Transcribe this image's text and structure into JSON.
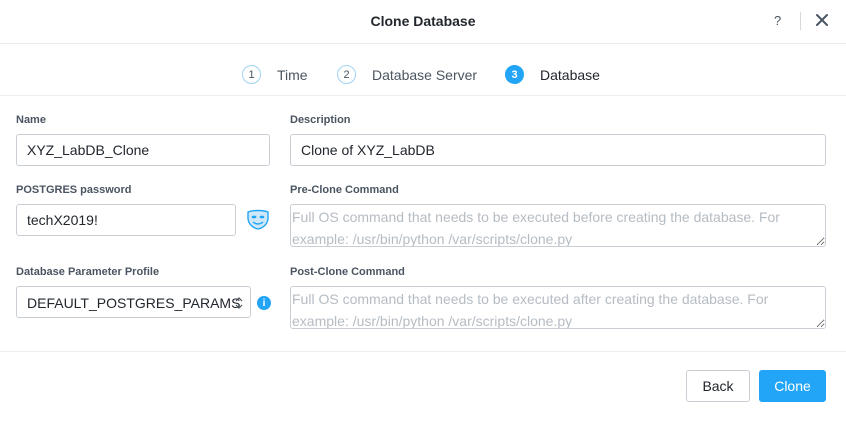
{
  "header": {
    "title": "Clone Database",
    "help_label": "?"
  },
  "steps": [
    {
      "number": "1",
      "label": "Time"
    },
    {
      "number": "2",
      "label": "Database Server"
    },
    {
      "number": "3",
      "label": "Database"
    }
  ],
  "form": {
    "name": {
      "label": "Name",
      "value": "XYZ_LabDB_Clone"
    },
    "description": {
      "label": "Description",
      "value": "Clone of XYZ_LabDB"
    },
    "password": {
      "label": "POSTGRES password",
      "value": "techX2019!"
    },
    "pre_clone": {
      "label": "Pre-Clone Command",
      "placeholder": "Full OS command that needs to be executed before creating the database. For example: /usr/bin/python /var/scripts/clone.py"
    },
    "param_profile": {
      "label": "Database Parameter Profile",
      "value": "DEFAULT_POSTGRES_PARAMS"
    },
    "post_clone": {
      "label": "Post-Clone Command",
      "placeholder": "Full OS command that needs to be executed after creating the database. For example: /usr/bin/python /var/scripts/clone.py"
    },
    "info_badge": "i"
  },
  "footer": {
    "back_label": "Back",
    "clone_label": "Clone"
  },
  "colors": {
    "accent": "#22a5f7",
    "border": "#c8ced4",
    "text": "#22272e",
    "muted": "#4a5561"
  }
}
